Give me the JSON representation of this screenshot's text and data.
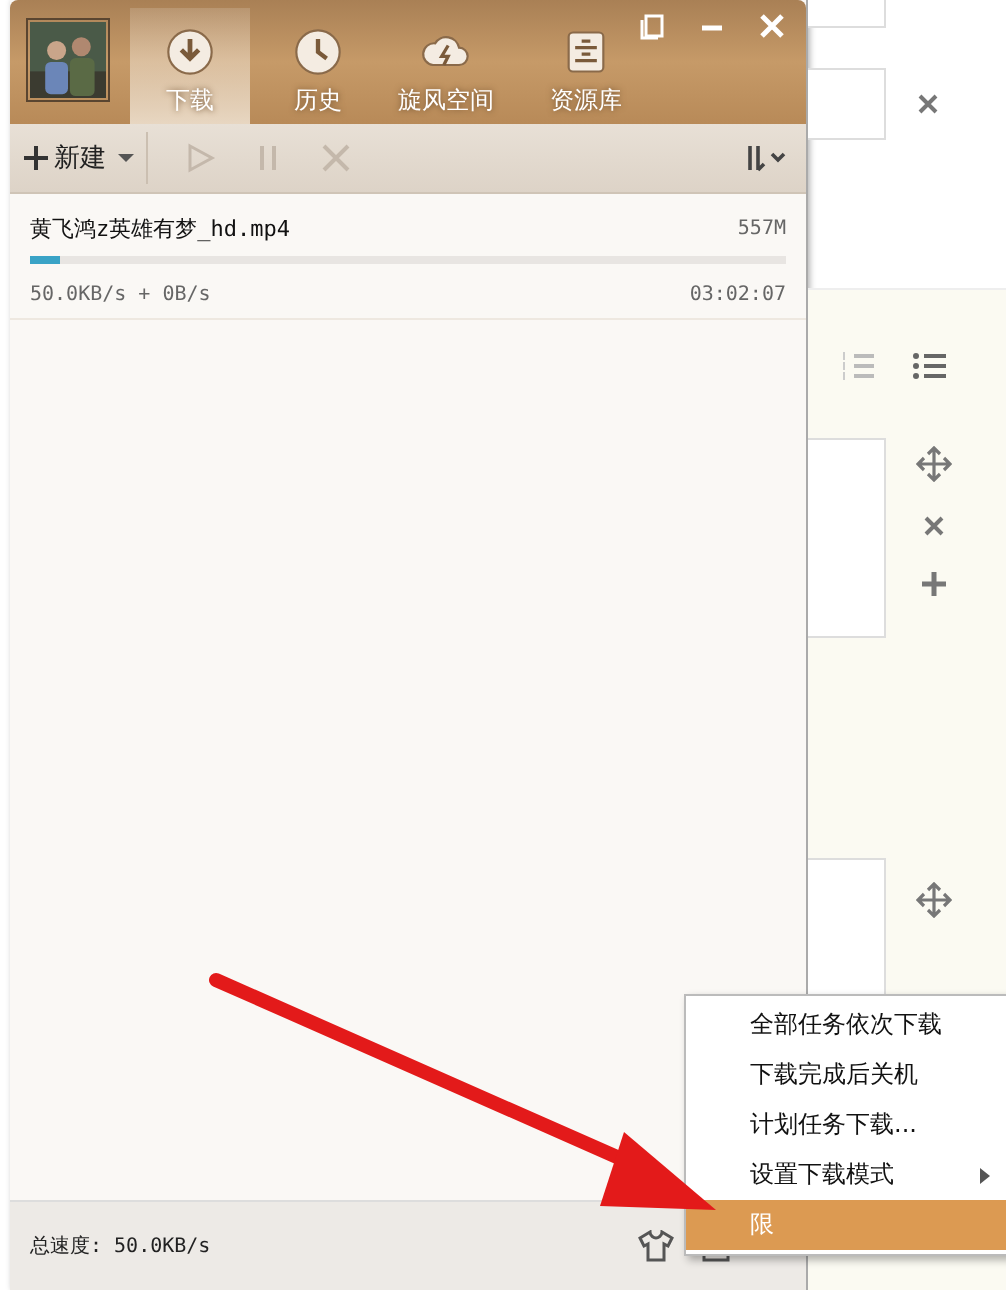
{
  "tabs": [
    {
      "label": "下载",
      "selected": true
    },
    {
      "label": "历史",
      "selected": false
    },
    {
      "label": "旋风空间",
      "selected": false
    },
    {
      "label": "资源库",
      "selected": false
    }
  ],
  "toolbar": {
    "new_button": "新建"
  },
  "tasks": [
    {
      "name": "黄飞鸿z英雄有梦_hd.mp4",
      "size": "557M",
      "level": 0.04,
      "speed": "50.0KB/s + 0B/s",
      "time": "03:02:07"
    }
  ],
  "status_bar": {
    "total_speed": "总速度: 50.0KB/s"
  },
  "menu": [
    {
      "label": "全部任务依次下载",
      "submenu": false,
      "selected": false
    },
    {
      "label": "下载完成后关机",
      "submenu": false,
      "selected": false
    },
    {
      "label": "计划任务下载...",
      "submenu": false,
      "selected": false
    },
    {
      "label": "设置下载模式",
      "submenu": true,
      "selected": false
    },
    {
      "label": "限",
      "submenu": false,
      "selected": true
    }
  ]
}
